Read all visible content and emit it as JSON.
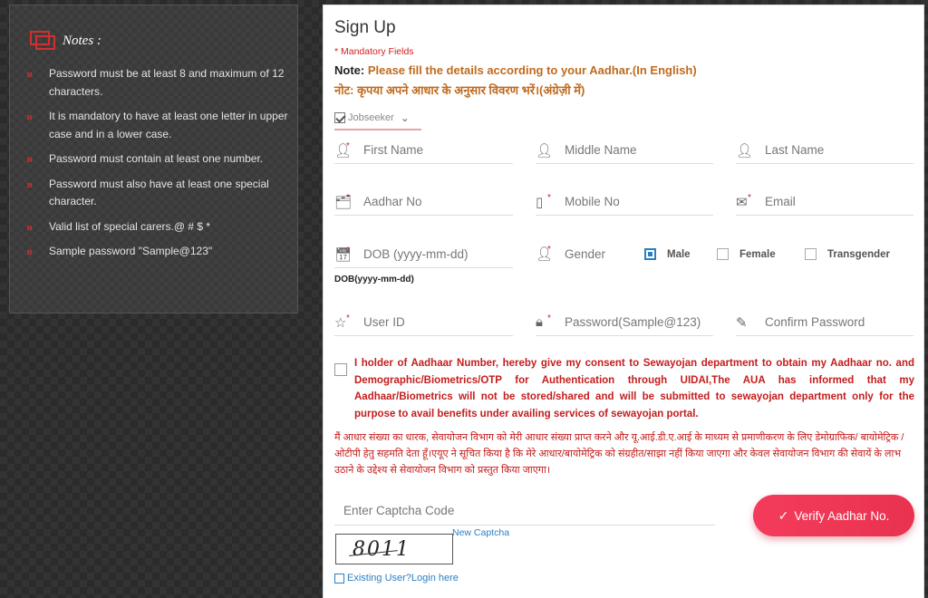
{
  "notes": {
    "title": "Notes :",
    "items": [
      "Password must be at least 8 and maximum of 12 characters.",
      "It is mandatory to have at least one letter in upper case and in a lower case.",
      "Password must contain at least one number.",
      "Password must also have at least one special character.",
      "Valid list of special carers.@ # $ *",
      "Sample password \"Sample@123\""
    ]
  },
  "form": {
    "title": "Sign Up",
    "mandatory": "* Mandatory Fields",
    "note_label": "Note:",
    "note_en": " Please fill the details according to your Aadhar.(In English)",
    "note_hi": "नोट: कृपया अपने आधार के अनुसार विवरण भरें।(अंग्रेज़ी में)",
    "role": "Jobseeker",
    "fields": {
      "first_name": "First Name",
      "middle_name": "Middle Name",
      "last_name": "Last Name",
      "aadhar": "Aadhar No",
      "mobile": "Mobile No",
      "email": "Email",
      "dob": "DOB (yyyy-mm-dd)",
      "gender": "Gender",
      "user_id": "User ID",
      "password": "Password(Sample@123)",
      "confirm_password": "Confirm Password"
    },
    "dob_hint": "DOB(yyyy-mm-dd)",
    "gender_options": {
      "male": "Male",
      "female": "Female",
      "transgender": "Transgender",
      "selected": "Male"
    },
    "consent_en": "I holder of Aadhaar Number, hereby give my consent to Sewayojan department to obtain my Aadhaar no. and Demographic/Biometrics/OTP for Authentication through UIDAI,The AUA has informed that my Aadhaar/Biometrics will not be stored/shared and will be submitted to sewayojan department only for the purpose to avail benefits under availing services of sewayojan portal.",
    "consent_hi": "मैं आधार संख्या का धारक, सेवायोजन विभाग को मेरी आधार संख्या प्राप्त करने और यू.आई.डी.ए.आई के माध्यम से प्रमाणीकरण के लिए डेमोग्राफिक/ बायोमेट्रिक / ओटीपी हेतु सहमति देता हूँ।एयूए ने सूचित किया है कि मेरे आधार/बायोमेट्रिक को संग्रहीत/साझा नहीं किया जाएगा और केवल सेवायोजन विभाग की सेवायें के लाभ उठाने के उद्देश्य से सेवायोजन विभाग को प्रस्तुत किया जाएगा।",
    "captcha_placeholder": "Enter Captcha Code",
    "verify_button": "Verify Aadhar No.",
    "new_captcha": "New Captcha",
    "captcha_value": "8011",
    "existing_user": "Existing User?Login here"
  },
  "colors": {
    "accent": "#e9324f",
    "link": "#2a7fc4",
    "warning": "#c41d1d"
  }
}
